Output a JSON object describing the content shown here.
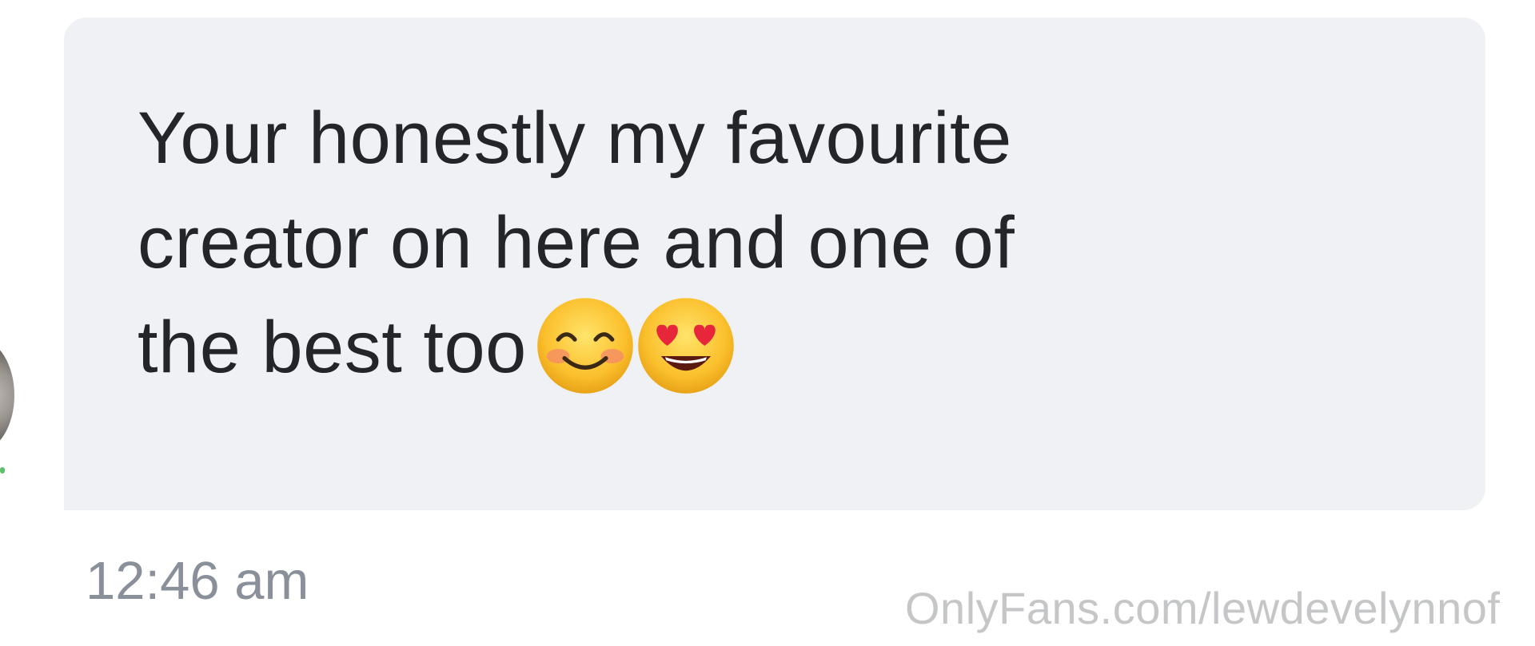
{
  "message": {
    "lines": [
      "Your honestly my favourite",
      "creator on here and one of",
      "the best too"
    ],
    "emojis": [
      "smiling-face-with-smiling-eyes-icon",
      "smiling-face-with-heart-eyes-icon"
    ]
  },
  "timestamp": "12:46 am",
  "watermark": "OnlyFans.com/lewdevelynnof",
  "colors": {
    "bubble": "#f0f1f4",
    "text": "#242529",
    "timestamp": "#8a9099",
    "watermark": "#c5c6c8",
    "online": "#5cc16a"
  }
}
